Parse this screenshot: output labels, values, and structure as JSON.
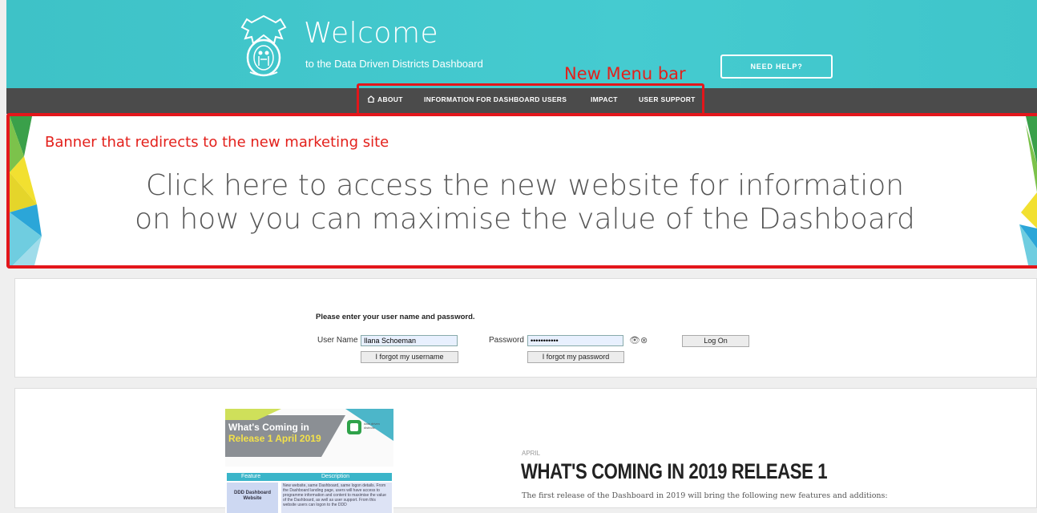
{
  "header": {
    "title": "Welcome",
    "subtitle": "to the Data Driven Districts Dashboard",
    "help_button": "NEED HELP?",
    "annotation": "New Menu bar",
    "colors": {
      "teal": "#45cbd0",
      "annotation_red": "#e3161b"
    }
  },
  "menu": {
    "items": [
      {
        "label": "ABOUT",
        "icon": "home-icon"
      },
      {
        "label": "INFORMATION FOR DASHBOARD USERS"
      },
      {
        "label": "IMPACT"
      },
      {
        "label": "USER SUPPORT"
      }
    ],
    "bar_color": "#4b4b4b"
  },
  "banner": {
    "annotation": "Banner that redirects to the new marketing site",
    "line1": "Click here to access the new website for information",
    "line2": "on how you can maximise the value of the Dashboard"
  },
  "login": {
    "prompt": "Please enter your user name and password.",
    "username_label": "User Name",
    "username_value": "Ilana Schoeman",
    "password_label": "Password",
    "password_value": "•••••••••••",
    "logon_button": "Log On",
    "forgot_username": "I forgot my username",
    "forgot_password": "I forgot my password",
    "eye_icon": "eye-icon",
    "clear_icon": "clear-icon"
  },
  "news": {
    "thumb": {
      "title_line1": "What's Coming in",
      "title_line2": "Release 1 April 2019",
      "logo_text": "data driven districts",
      "col_feature": "Feature",
      "col_description": "Description",
      "row_feature": "DDD Dashboard Website",
      "row_description": "New website, same Dashboard, same logon details. From the Dashboard landing page, users will have access to programme information and content to maximise the value of the Dashboard, as well as user support. From this website users can logon to the DDD"
    },
    "month": "APRIL",
    "title": "WHAT'S COMING IN 2019 RELEASE 1",
    "body": "The first release of the Dashboard in 2019 will bring the following new features and additions:"
  }
}
